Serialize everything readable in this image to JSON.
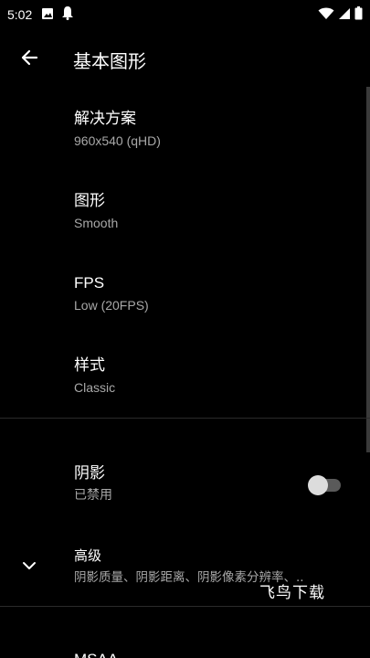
{
  "status_bar": {
    "time": "5:02",
    "left_icons": [
      "image-icon",
      "notification-bell-icon"
    ],
    "right_icons": [
      "wifi-icon",
      "signal-icon",
      "battery-icon"
    ]
  },
  "toolbar": {
    "title": "基本图形"
  },
  "preferences": [
    {
      "title": "解决方案",
      "summary": "960x540 (qHD)"
    },
    {
      "title": "图形",
      "summary": "Smooth"
    },
    {
      "title": "FPS",
      "summary": "Low (20FPS)"
    },
    {
      "title": "样式",
      "summary": "Classic"
    }
  ],
  "shadow": {
    "title": "阴影",
    "summary": "已禁用",
    "enabled": false
  },
  "advanced": {
    "title": "高级",
    "summary": "阴影质量、阴影距离、阴影像素分辨率、.."
  },
  "partial_item": {
    "title": "MSAA"
  },
  "watermark": "飞鸟下载",
  "colors": {
    "background": "#000000",
    "text_primary": "#ffffff",
    "text_secondary": "#a8a8a8",
    "divider": "#2a2a2a"
  }
}
